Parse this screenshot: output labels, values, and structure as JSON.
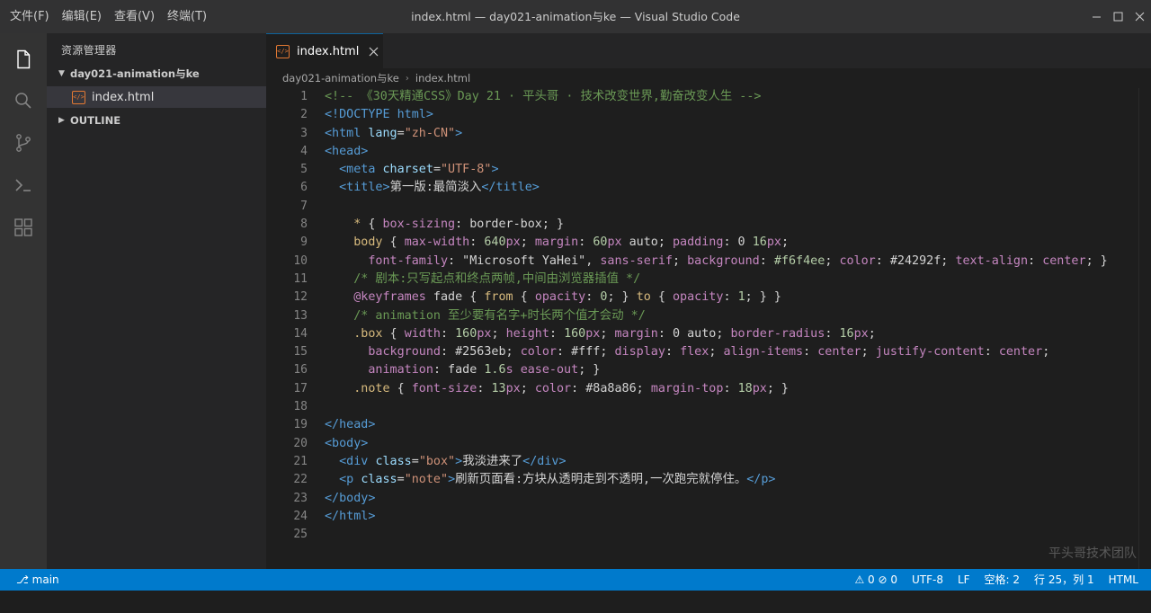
{
  "menu": [
    "文件(F)",
    "编辑(E)",
    "查看(V)",
    "终端(T)"
  ],
  "window_title": "index.html — day021-animation与ke — Visual Studio Code",
  "sidebar": {
    "title": "资源管理器",
    "folder": "day021-animation与ke",
    "file": "index.html",
    "outline": "OUTLINE"
  },
  "tab": {
    "label": "index.html",
    "icon_text": "</>"
  },
  "breadcrumb": {
    "folder": "day021-animation与ke",
    "separator": "›",
    "file": "index.html"
  },
  "line_numbers": [
    "1",
    "2",
    "3",
    "4",
    "5",
    "6",
    "7",
    "8",
    "9",
    "10",
    "11",
    "12",
    "13",
    "14",
    "15",
    "16",
    "17",
    "18",
    "19",
    "20",
    "21",
    "22",
    "23",
    "24",
    "25"
  ],
  "code_lines": [
    [
      [
        "com",
        "<!-- 《30天精通CSS》Day 21 · 平头哥 · 技术改变世界,勤奋改变人生 -->"
      ]
    ],
    [
      [
        "tag",
        "<!DOCTYPE html>"
      ]
    ],
    [
      [
        "tag",
        "<html "
      ],
      [
        "attr",
        "lang"
      ],
      [
        "txt",
        "="
      ],
      [
        "str",
        "\"zh-CN\""
      ],
      [
        "tag",
        ">"
      ]
    ],
    [
      [
        "tag",
        "<head>"
      ]
    ],
    [
      [
        "txt",
        "  "
      ],
      [
        "tag",
        "<meta "
      ],
      [
        "attr",
        "charset"
      ],
      [
        "txt",
        "="
      ],
      [
        "str",
        "\"UTF-8\""
      ],
      [
        "tag",
        ">"
      ]
    ],
    [
      [
        "txt",
        "  "
      ],
      [
        "tag",
        "<title>"
      ],
      [
        "txt",
        "第一版:最简淡入"
      ],
      [
        "tag",
        "</title>"
      ]
    ],
    [
      [
        "txt",
        ""
      ]
    ],
    [
      [
        "txt",
        "    "
      ],
      [
        "sel",
        "*"
      ],
      [
        "txt",
        " { "
      ],
      [
        "prop",
        "box-sizing"
      ],
      [
        "txt",
        ": border-box; }"
      ]
    ],
    [
      [
        "txt",
        "    "
      ],
      [
        "sel",
        "body"
      ],
      [
        "txt",
        " { "
      ],
      [
        "prop",
        "max-width"
      ],
      [
        "txt",
        ": "
      ],
      [
        "num",
        "640"
      ],
      [
        "prop",
        "px"
      ],
      [
        "txt",
        "; "
      ],
      [
        "prop",
        "margin"
      ],
      [
        "txt",
        ": "
      ],
      [
        "num",
        "60"
      ],
      [
        "prop",
        "px"
      ],
      [
        "txt",
        " auto; "
      ],
      [
        "prop",
        "padding"
      ],
      [
        "txt",
        ": 0 "
      ],
      [
        "num",
        "16"
      ],
      [
        "prop",
        "px"
      ],
      [
        "txt",
        ";"
      ]
    ],
    [
      [
        "txt",
        "      "
      ],
      [
        "prop",
        "font-family"
      ],
      [
        "txt",
        ": \"Microsoft YaHei\", "
      ],
      [
        "prop",
        "sans-serif"
      ],
      [
        "txt",
        "; "
      ],
      [
        "prop",
        "background"
      ],
      [
        "txt",
        ": "
      ],
      [
        "num",
        "#f6f4ee"
      ],
      [
        "txt",
        "; "
      ],
      [
        "prop",
        "color"
      ],
      [
        "txt",
        ": #24292f; "
      ],
      [
        "prop",
        "text-align"
      ],
      [
        "txt",
        ": "
      ],
      [
        "prop",
        "center"
      ],
      [
        "txt",
        "; }"
      ]
    ],
    [
      [
        "txt",
        "    "
      ],
      [
        "com",
        "/* 剧本:只写起点和终点两帧,中间由浏览器插值 */"
      ]
    ],
    [
      [
        "txt",
        "    "
      ],
      [
        "prop",
        "@keyframes"
      ],
      [
        "txt",
        " fade { "
      ],
      [
        "sel",
        "from"
      ],
      [
        "txt",
        " { "
      ],
      [
        "prop",
        "opacity"
      ],
      [
        "txt",
        ": "
      ],
      [
        "num",
        "0"
      ],
      [
        "txt",
        "; } "
      ],
      [
        "sel",
        "to"
      ],
      [
        "txt",
        " { "
      ],
      [
        "prop",
        "opacity"
      ],
      [
        "txt",
        ": "
      ],
      [
        "num",
        "1"
      ],
      [
        "txt",
        "; } }"
      ]
    ],
    [
      [
        "txt",
        "    "
      ],
      [
        "com",
        "/* animation 至少要有名字+时长两个值才会动 */"
      ]
    ],
    [
      [
        "txt",
        "    "
      ],
      [
        "sel",
        ".box"
      ],
      [
        "txt",
        " { "
      ],
      [
        "prop",
        "width"
      ],
      [
        "txt",
        ": "
      ],
      [
        "num",
        "160"
      ],
      [
        "prop",
        "px"
      ],
      [
        "txt",
        "; "
      ],
      [
        "prop",
        "height"
      ],
      [
        "txt",
        ": "
      ],
      [
        "num",
        "160"
      ],
      [
        "prop",
        "px"
      ],
      [
        "txt",
        "; "
      ],
      [
        "prop",
        "margin"
      ],
      [
        "txt",
        ": 0 auto; "
      ],
      [
        "prop",
        "border-radius"
      ],
      [
        "txt",
        ": "
      ],
      [
        "num",
        "16"
      ],
      [
        "prop",
        "px"
      ],
      [
        "txt",
        ";"
      ]
    ],
    [
      [
        "txt",
        "      "
      ],
      [
        "prop",
        "background"
      ],
      [
        "txt",
        ": #2563eb; "
      ],
      [
        "prop",
        "color"
      ],
      [
        "txt",
        ": #fff; "
      ],
      [
        "prop",
        "display"
      ],
      [
        "txt",
        ": "
      ],
      [
        "prop",
        "flex"
      ],
      [
        "txt",
        "; "
      ],
      [
        "prop",
        "align-items"
      ],
      [
        "txt",
        ": "
      ],
      [
        "prop",
        "center"
      ],
      [
        "txt",
        "; "
      ],
      [
        "prop",
        "justify-content"
      ],
      [
        "txt",
        ": "
      ],
      [
        "prop",
        "center"
      ],
      [
        "txt",
        ";"
      ]
    ],
    [
      [
        "txt",
        "      "
      ],
      [
        "prop",
        "animation"
      ],
      [
        "txt",
        ": fade "
      ],
      [
        "num",
        "1.6"
      ],
      [
        "prop",
        "s"
      ],
      [
        "txt",
        " "
      ],
      [
        "prop",
        "ease-out"
      ],
      [
        "txt",
        "; }"
      ]
    ],
    [
      [
        "txt",
        "    "
      ],
      [
        "sel",
        ".note"
      ],
      [
        "txt",
        " { "
      ],
      [
        "prop",
        "font-size"
      ],
      [
        "txt",
        ": "
      ],
      [
        "num",
        "13"
      ],
      [
        "prop",
        "px"
      ],
      [
        "txt",
        "; "
      ],
      [
        "prop",
        "color"
      ],
      [
        "txt",
        ": #8a8a86; "
      ],
      [
        "prop",
        "margin-top"
      ],
      [
        "txt",
        ": "
      ],
      [
        "num",
        "18"
      ],
      [
        "prop",
        "px"
      ],
      [
        "txt",
        "; }"
      ]
    ],
    [
      [
        "txt",
        ""
      ]
    ],
    [
      [
        "tag",
        "</head>"
      ]
    ],
    [
      [
        "tag",
        "<body>"
      ]
    ],
    [
      [
        "txt",
        "  "
      ],
      [
        "tag",
        "<div "
      ],
      [
        "attr",
        "class"
      ],
      [
        "txt",
        "="
      ],
      [
        "str",
        "\"box\""
      ],
      [
        "tag",
        ">"
      ],
      [
        "txt",
        "我淡进来了"
      ],
      [
        "tag",
        "</div>"
      ]
    ],
    [
      [
        "txt",
        "  "
      ],
      [
        "tag",
        "<p "
      ],
      [
        "attr",
        "class"
      ],
      [
        "txt",
        "="
      ],
      [
        "str",
        "\"note\""
      ],
      [
        "tag",
        ">"
      ],
      [
        "txt",
        "刷新页面看:方块从透明走到不透明,一次跑完就停住。"
      ],
      [
        "tag",
        "</p>"
      ]
    ],
    [
      [
        "tag",
        "</body>"
      ]
    ],
    [
      [
        "tag",
        "</html>"
      ]
    ],
    [
      [
        "txt",
        ""
      ]
    ]
  ],
  "watermark": "平头哥技术团队",
  "status": {
    "branch": "main",
    "problems": "⚠ 0  ⊘ 0",
    "encoding": "UTF-8",
    "eol": "LF",
    "indent": "空格: 2",
    "position": "行 25，列 1",
    "language": "HTML"
  },
  "icons": {
    "activity": [
      "files-icon",
      "search-icon",
      "source-control-icon",
      "terminal-icon",
      "extensions-icon"
    ],
    "window": [
      "minimize-icon",
      "maximize-icon",
      "close-icon"
    ]
  },
  "colors": {
    "statusbar": "#007acc",
    "titlebar": "#323233",
    "activitybar": "#333333",
    "sidebar": "#252526",
    "editor": "#1e1e1e",
    "html_file_icon": "#e37933"
  }
}
